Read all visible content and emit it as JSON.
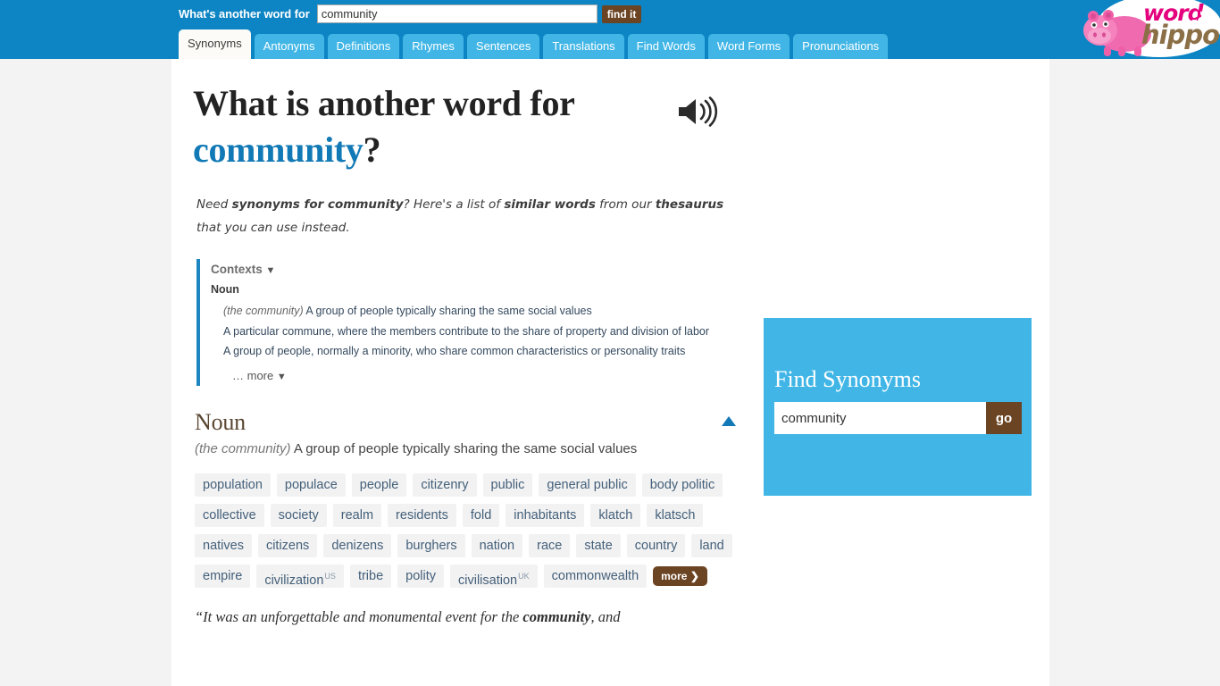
{
  "header": {
    "search_label": "What's another word for",
    "search_value": "community",
    "search_placeholder": "",
    "find_button": "find it",
    "brightness_icon": "sun-icon",
    "tabs": [
      {
        "label": "Synonyms",
        "active": true
      },
      {
        "label": "Antonyms",
        "active": false
      },
      {
        "label": "Definitions",
        "active": false
      },
      {
        "label": "Rhymes",
        "active": false
      },
      {
        "label": "Sentences",
        "active": false
      },
      {
        "label": "Translations",
        "active": false
      },
      {
        "label": "Find Words",
        "active": false
      },
      {
        "label": "Word Forms",
        "active": false
      },
      {
        "label": "Pronunciations",
        "active": false
      }
    ]
  },
  "logo": {
    "word": "word",
    "hippo": "hippo",
    "mascot_icon": "hippo-icon"
  },
  "main": {
    "title_prefix": "What is another word for",
    "title_keyword": "community",
    "title_suffix": "?",
    "speaker_icon": "speaker-icon",
    "intro": {
      "p1": "Need ",
      "b1": "synonyms for community",
      "p2": "? Here's a list of ",
      "b2": "similar words",
      "p3": " from our ",
      "b3": "thesaurus",
      "p4": " that you can use instead."
    },
    "contexts": {
      "header": "Contexts",
      "header_caret": "▼",
      "pos": "Noun",
      "items": [
        {
          "qualifier": "(the community)",
          "text": " A group of people typically sharing the same social values"
        },
        {
          "qualifier": "",
          "text": "A particular commune, where the members contribute to the share of property and division of labor"
        },
        {
          "qualifier": "",
          "text": "A group of people, normally a minority, who share common characteristics or personality traits"
        }
      ],
      "more_label": "… more",
      "more_caret": "▼"
    },
    "synonyms": {
      "pos": "Noun",
      "collapse_icon": "triangle-up-icon",
      "def_qualifier": "(the community)",
      "def_text": " A group of people typically sharing the same social values",
      "chips": [
        {
          "word": "population",
          "sup": ""
        },
        {
          "word": "populace",
          "sup": ""
        },
        {
          "word": "people",
          "sup": ""
        },
        {
          "word": "citizenry",
          "sup": ""
        },
        {
          "word": "public",
          "sup": ""
        },
        {
          "word": "general public",
          "sup": ""
        },
        {
          "word": "body politic",
          "sup": ""
        },
        {
          "word": "collective",
          "sup": ""
        },
        {
          "word": "society",
          "sup": ""
        },
        {
          "word": "realm",
          "sup": ""
        },
        {
          "word": "residents",
          "sup": ""
        },
        {
          "word": "fold",
          "sup": ""
        },
        {
          "word": "inhabitants",
          "sup": ""
        },
        {
          "word": "klatch",
          "sup": ""
        },
        {
          "word": "klatsch",
          "sup": ""
        },
        {
          "word": "natives",
          "sup": ""
        },
        {
          "word": "citizens",
          "sup": ""
        },
        {
          "word": "denizens",
          "sup": ""
        },
        {
          "word": "burghers",
          "sup": ""
        },
        {
          "word": "nation",
          "sup": ""
        },
        {
          "word": "race",
          "sup": ""
        },
        {
          "word": "state",
          "sup": ""
        },
        {
          "word": "country",
          "sup": ""
        },
        {
          "word": "land",
          "sup": ""
        },
        {
          "word": "empire",
          "sup": ""
        },
        {
          "word": "civilization",
          "sup": "US"
        },
        {
          "word": "tribe",
          "sup": ""
        },
        {
          "word": "polity",
          "sup": ""
        },
        {
          "word": "civilisation",
          "sup": "UK"
        },
        {
          "word": "commonwealth",
          "sup": ""
        }
      ],
      "more_label": "more ❯"
    },
    "quote": {
      "pre": "“It was an unforgettable and monumental event for the ",
      "bold": "community",
      "post": ", and"
    }
  },
  "sidebar": {
    "title": "Find Synonyms",
    "input_value": "community",
    "input_placeholder": "",
    "go_label": "go"
  },
  "colors": {
    "header_blue": "#0d85c4",
    "tab_blue": "#41b6e6",
    "accent_brown": "#6b4423",
    "keyword_blue": "#1179b5",
    "chip_bg": "#f2f2f2",
    "page_bg": "#f3f3f3"
  }
}
